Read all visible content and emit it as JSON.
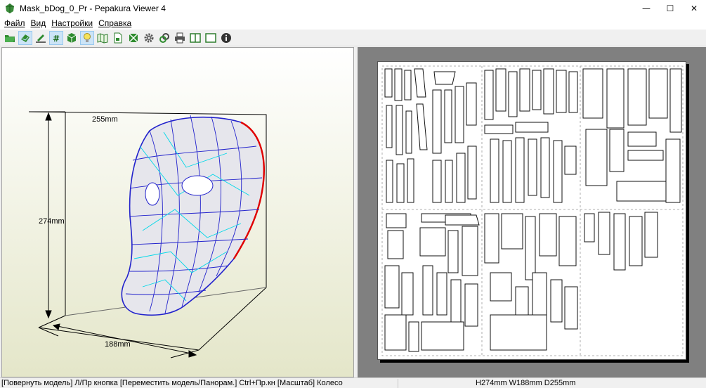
{
  "window": {
    "title": "Mask_bDog_0_Pr - Pepakura Viewer 4",
    "minimize_glyph": "—",
    "maximize_glyph": "☐",
    "close_glyph": "✕"
  },
  "menu": {
    "items": [
      {
        "label": "Файл"
      },
      {
        "label": "Вид"
      },
      {
        "label": "Настройки"
      },
      {
        "label": "Справка"
      }
    ]
  },
  "toolbar": {
    "tools": [
      {
        "icon": "open-folder-icon",
        "pressed": false
      },
      {
        "icon": "3d-view-icon",
        "pressed": true
      },
      {
        "icon": "edit-line-icon",
        "pressed": false
      },
      {
        "icon": "grid-icon",
        "pressed": true
      },
      {
        "icon": "cube-icon",
        "pressed": false
      },
      {
        "icon": "lightbulb-icon",
        "pressed": true
      },
      {
        "icon": "map-icon",
        "pressed": false
      },
      {
        "icon": "page-icon",
        "pressed": false
      },
      {
        "icon": "texture-icon",
        "pressed": false
      },
      {
        "icon": "gear-icon",
        "pressed": false
      },
      {
        "icon": "link-icon",
        "pressed": false
      },
      {
        "icon": "printer-icon",
        "pressed": false
      },
      {
        "icon": "split-view-icon",
        "pressed": false
      },
      {
        "icon": "single-view-icon",
        "pressed": false
      },
      {
        "icon": "info-icon",
        "pressed": false
      }
    ]
  },
  "model_view": {
    "dim_width": "255mm",
    "dim_height": "274mm",
    "dim_depth": "188mm"
  },
  "status": {
    "hint": "[Повернуть модель] Л/Пр кнопка [Переместить модель/Панорам.] Ctrl+Пр.кн [Масштаб] Колесо",
    "dimensions": "H274mm W188mm D255mm"
  },
  "colors": {
    "model_edges": "#2222cc",
    "fold_lines": "#00d8e8",
    "cut_edges": "#e00000",
    "face_fill": "#e8e8ec"
  }
}
